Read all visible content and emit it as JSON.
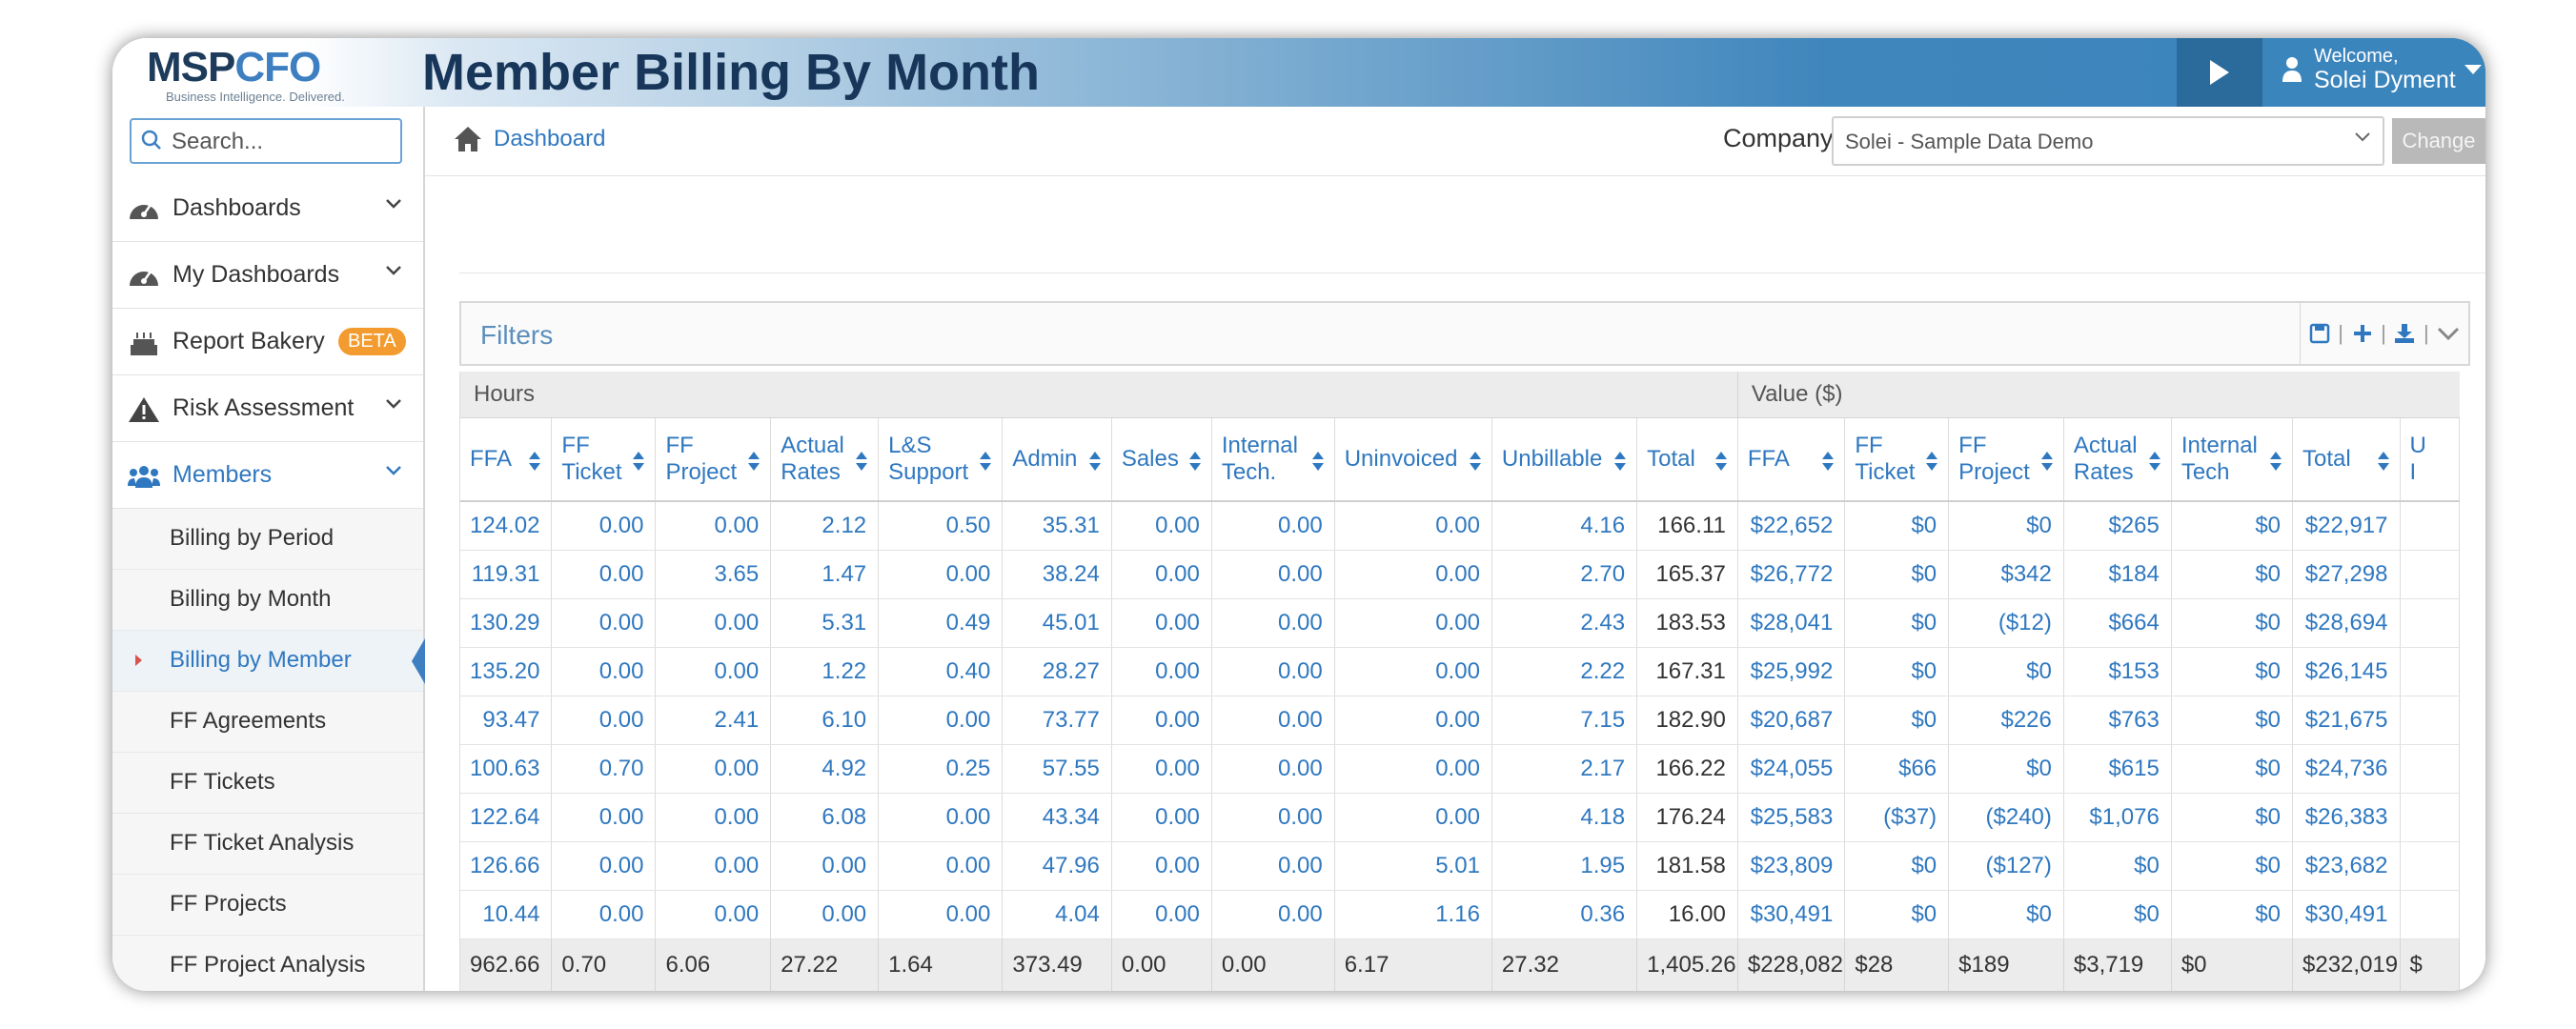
{
  "app": {
    "logo_main": "MSP",
    "logo_accent": "CFO",
    "tagline": "Business Intelligence. Delivered.",
    "page_title": "Member Billing By Month"
  },
  "user": {
    "welcome": "Welcome,",
    "name": "Solei Dyment"
  },
  "search": {
    "placeholder": "Search..."
  },
  "sidebar": {
    "items": [
      {
        "label": "Dashboards",
        "icon": "dashboard-icon"
      },
      {
        "label": "My Dashboards",
        "icon": "dashboard-icon"
      },
      {
        "label": "Report Bakery",
        "icon": "cake-icon",
        "badge": "BETA"
      },
      {
        "label": "Risk Assessment",
        "icon": "warning-icon"
      },
      {
        "label": "Members",
        "icon": "users-icon"
      }
    ],
    "sub_items": [
      {
        "label": "Billing by Period"
      },
      {
        "label": "Billing by Month"
      },
      {
        "label": "Billing by Member"
      },
      {
        "label": "FF Agreements"
      },
      {
        "label": "FF Tickets"
      },
      {
        "label": "FF Ticket Analysis"
      },
      {
        "label": "FF Projects"
      },
      {
        "label": "FF Project Analysis"
      }
    ]
  },
  "breadcrumb": {
    "label": "Dashboard"
  },
  "company": {
    "label": "Company:",
    "selected": "Solei - Sample Data Demo",
    "change_label": "Change"
  },
  "filters": {
    "title": "Filters",
    "separator": "|"
  },
  "table": {
    "groups": {
      "hours": "Hours",
      "value": "Value ($)"
    },
    "columns": [
      [
        "FFA"
      ],
      [
        "FF",
        "Ticket"
      ],
      [
        "FF",
        "Project"
      ],
      [
        "Actual",
        "Rates"
      ],
      [
        "L&S",
        "Support"
      ],
      [
        "Admin"
      ],
      [
        "Sales"
      ],
      [
        "Internal",
        "Tech."
      ],
      [
        "Uninvoiced"
      ],
      [
        "Unbillable"
      ],
      [
        "Total"
      ],
      [
        "FFA"
      ],
      [
        "FF",
        "Ticket"
      ],
      [
        "FF",
        "Project"
      ],
      [
        "Actual",
        "Rates"
      ],
      [
        "Internal",
        "Tech"
      ],
      [
        "Total"
      ],
      [
        "U",
        "I"
      ]
    ],
    "rows": [
      [
        "124.02",
        "0.00",
        "0.00",
        "2.12",
        "0.50",
        "35.31",
        "0.00",
        "0.00",
        "0.00",
        "4.16",
        "166.11",
        "$22,652",
        "$0",
        "$0",
        "$265",
        "$0",
        "$22,917"
      ],
      [
        "119.31",
        "0.00",
        "3.65",
        "1.47",
        "0.00",
        "38.24",
        "0.00",
        "0.00",
        "0.00",
        "2.70",
        "165.37",
        "$26,772",
        "$0",
        "$342",
        "$184",
        "$0",
        "$27,298"
      ],
      [
        "130.29",
        "0.00",
        "0.00",
        "5.31",
        "0.49",
        "45.01",
        "0.00",
        "0.00",
        "0.00",
        "2.43",
        "183.53",
        "$28,041",
        "$0",
        "($12)",
        "$664",
        "$0",
        "$28,694"
      ],
      [
        "135.20",
        "0.00",
        "0.00",
        "1.22",
        "0.40",
        "28.27",
        "0.00",
        "0.00",
        "0.00",
        "2.22",
        "167.31",
        "$25,992",
        "$0",
        "$0",
        "$153",
        "$0",
        "$26,145"
      ],
      [
        "93.47",
        "0.00",
        "2.41",
        "6.10",
        "0.00",
        "73.77",
        "0.00",
        "0.00",
        "0.00",
        "7.15",
        "182.90",
        "$20,687",
        "$0",
        "$226",
        "$763",
        "$0",
        "$21,675"
      ],
      [
        "100.63",
        "0.70",
        "0.00",
        "4.92",
        "0.25",
        "57.55",
        "0.00",
        "0.00",
        "0.00",
        "2.17",
        "166.22",
        "$24,055",
        "$66",
        "$0",
        "$615",
        "$0",
        "$24,736"
      ],
      [
        "122.64",
        "0.00",
        "0.00",
        "6.08",
        "0.00",
        "43.34",
        "0.00",
        "0.00",
        "0.00",
        "4.18",
        "176.24",
        "$25,583",
        "($37)",
        "($240)",
        "$1,076",
        "$0",
        "$26,383"
      ],
      [
        "126.66",
        "0.00",
        "0.00",
        "0.00",
        "0.00",
        "47.96",
        "0.00",
        "0.00",
        "5.01",
        "1.95",
        "181.58",
        "$23,809",
        "$0",
        "($127)",
        "$0",
        "$0",
        "$23,682"
      ],
      [
        "10.44",
        "0.00",
        "0.00",
        "0.00",
        "0.00",
        "4.04",
        "0.00",
        "0.00",
        "1.16",
        "0.36",
        "16.00",
        "$30,491",
        "$0",
        "$0",
        "$0",
        "$0",
        "$30,491"
      ]
    ],
    "totals": [
      "962.66",
      "0.70",
      "6.06",
      "27.22",
      "1.64",
      "373.49",
      "0.00",
      "0.00",
      "6.17",
      "27.32",
      "1,405.26",
      "$228,082",
      "$28",
      "$189",
      "$3,719",
      "$0",
      "$232,019",
      "$"
    ]
  },
  "colors": {
    "accent": "#2f78c0",
    "header_dark": "#17365a",
    "badge": "#f39b2e"
  }
}
